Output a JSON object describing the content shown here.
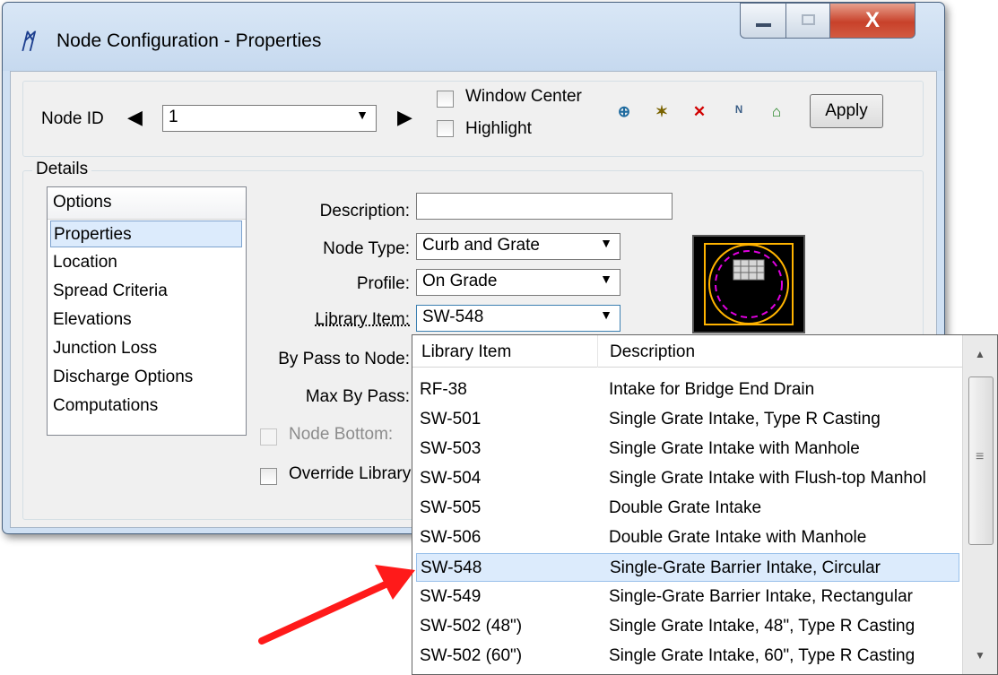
{
  "window": {
    "title": "Node Configuration - Properties",
    "app_icon_glyph": "ᛗ",
    "close_glyph": "X"
  },
  "toolbar": {
    "node_id_label": "Node ID",
    "node_id_value": "1",
    "prev_glyph": "◀",
    "next_glyph": "▶",
    "window_center_label": "Window Center",
    "highlight_label": "Highlight",
    "apply_label": "Apply",
    "tools": [
      {
        "icon": "add-node-icon"
      },
      {
        "icon": "new-node-icon"
      },
      {
        "icon": "delete-node-icon"
      },
      {
        "icon": "north-node-icon"
      },
      {
        "icon": "library-node-icon"
      }
    ]
  },
  "details": {
    "group_label": "Details",
    "options_header": "Options",
    "options": [
      "Properties",
      "Location",
      "Spread Criteria",
      "Elevations",
      "Junction Loss",
      "Discharge Options",
      "Computations"
    ],
    "selected_option": "Properties",
    "description_label": "Description:",
    "description_value": "",
    "node_type_label": "Node Type:",
    "node_type_value": "Curb and Grate",
    "profile_label": "Profile:",
    "profile_value": "On Grade",
    "library_item_label": "Library Item:",
    "library_item_value": "SW-548",
    "bypass_label": "By Pass to Node:",
    "max_bypass_label": "Max By Pass:",
    "node_bottom_label": "Node Bottom:",
    "override_label": "Override Library"
  },
  "dropdown": {
    "col_item": "Library Item",
    "col_desc": "Description",
    "rows": [
      {
        "item": "RF-38",
        "desc": "Intake for Bridge End Drain"
      },
      {
        "item": "SW-501",
        "desc": "Single Grate Intake, Type R Casting"
      },
      {
        "item": "SW-503",
        "desc": "Single Grate Intake with Manhole"
      },
      {
        "item": "SW-504",
        "desc": "Single Grate Intake with Flush-top Manhol"
      },
      {
        "item": "SW-505",
        "desc": "Double Grate Intake"
      },
      {
        "item": "SW-506",
        "desc": "Double Grate Intake with Manhole"
      },
      {
        "item": "SW-548",
        "desc": "Single-Grate Barrier Intake, Circular"
      },
      {
        "item": "SW-549",
        "desc": "Single-Grate Barrier Intake, Rectangular"
      },
      {
        "item": "SW-502 (48\")",
        "desc": "Single Grate Intake, 48\", Type R Casting"
      },
      {
        "item": "SW-502 (60\")",
        "desc": "Single Grate Intake, 60\", Type R Casting"
      }
    ],
    "selected_row": 6,
    "scroll_up_glyph": "▲",
    "scroll_down_glyph": "▼",
    "grip_glyph": "≡"
  },
  "colors": {
    "annotation_arrow": "#ff1a1a",
    "selection": "#dcebfc",
    "preview_outline": "#ffb300",
    "preview_dash": "#e000e0"
  }
}
